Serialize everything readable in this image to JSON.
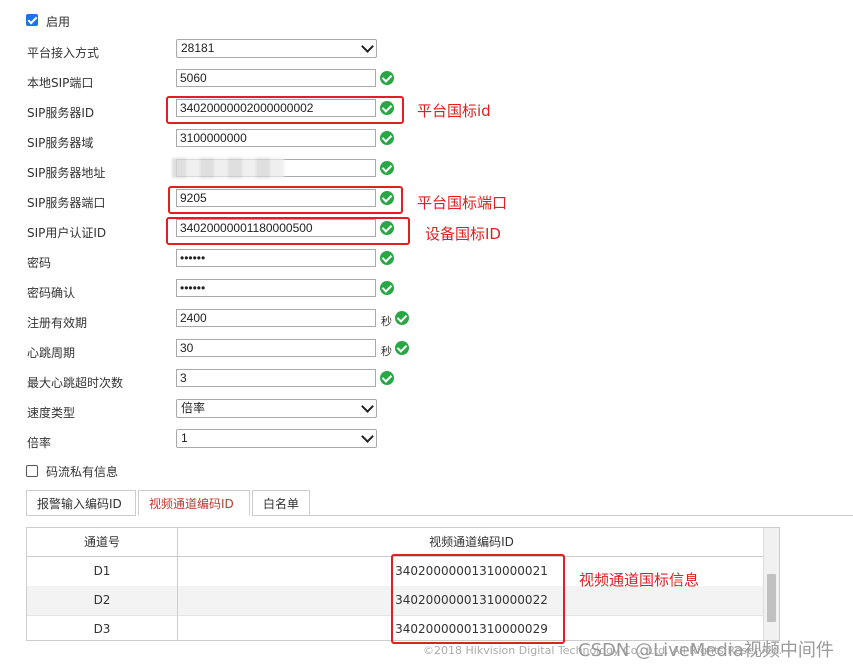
{
  "enable": {
    "label": "启用",
    "checked": true
  },
  "form": [
    {
      "id": "access_mode",
      "label": "平台接入方式",
      "type": "select",
      "value": "28181",
      "ok": false
    },
    {
      "id": "local_sip_port",
      "label": "本地SIP端口",
      "type": "input",
      "value": "5060",
      "ok": true
    },
    {
      "id": "sip_server_id",
      "label": "SIP服务器ID",
      "type": "input",
      "value": "34020000002000000002",
      "ok": true
    },
    {
      "id": "sip_server_domain",
      "label": "SIP服务器域",
      "type": "input",
      "value": "3100000000",
      "ok": true
    },
    {
      "id": "sip_server_addr",
      "label": "SIP服务器地址",
      "type": "input",
      "value": "",
      "ok": true
    },
    {
      "id": "sip_server_port",
      "label": "SIP服务器端口",
      "type": "input",
      "value": "9205",
      "ok": true
    },
    {
      "id": "sip_user_auth_id",
      "label": "SIP用户认证ID",
      "type": "input",
      "value": "34020000001180000500",
      "ok": true
    },
    {
      "id": "password",
      "label": "密码",
      "type": "input",
      "value": "••••••",
      "ok": true
    },
    {
      "id": "password_confirm",
      "label": "密码确认",
      "type": "input",
      "value": "••••••",
      "ok": true
    },
    {
      "id": "reg_validity",
      "label": "注册有效期",
      "type": "input",
      "value": "2400",
      "unit": "秒",
      "ok": true
    },
    {
      "id": "heartbeat",
      "label": "心跳周期",
      "type": "input",
      "value": "30",
      "unit": "秒",
      "ok": true
    },
    {
      "id": "max_heartbeat_timeout",
      "label": "最大心跳超时次数",
      "type": "input",
      "value": "3",
      "ok": true
    },
    {
      "id": "speed_type",
      "label": "速度类型",
      "type": "select",
      "value": "倍率",
      "ok": false
    },
    {
      "id": "rate",
      "label": "倍率",
      "type": "select",
      "value": "1",
      "ok": false
    }
  ],
  "stream_private": {
    "label": "码流私有信息",
    "checked": false
  },
  "tabs": [
    "报警输入编码ID",
    "视频通道编码ID",
    "白名单"
  ],
  "table": {
    "headers": [
      "通道号",
      "视频通道编码ID"
    ],
    "rows": [
      [
        "D1",
        "34020000001310000021"
      ],
      [
        "D2",
        "34020000001310000022"
      ],
      [
        "D3",
        "34020000001310000029"
      ]
    ]
  },
  "annotations": {
    "platform_id": "平台国标id",
    "platform_port": "平台国标端口",
    "device_id": "设备国标ID",
    "channel_info": "视频通道国标信息"
  },
  "footer": "©2018 Hikvision Digital Technology Co., Ltd. All Rights Reserved.",
  "watermark": "CSDN @LiveMedia视频中间件",
  "colors": {
    "ok_green": "#29a745",
    "annotation_red": "#e02020",
    "checkbox_blue": "#1a73e8"
  }
}
